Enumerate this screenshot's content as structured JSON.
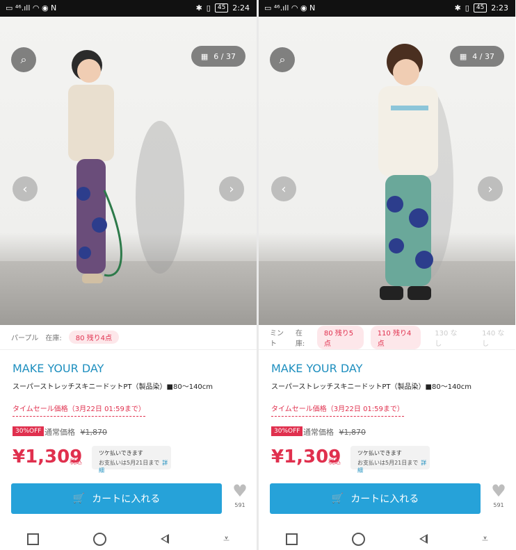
{
  "left": {
    "status": {
      "left_icons": "▭ ⁴⁶.ıll ◠ ◉ N",
      "battery": "45",
      "time": "2:24"
    },
    "counter": {
      "icon": "grid-icon",
      "text": "6 / 37"
    },
    "variants": {
      "color": "パープル",
      "stock_label": "在庫:",
      "chips": [
        {
          "label": "80 残り4点",
          "available": true
        }
      ]
    },
    "product": {
      "brand": "MAKE YOUR DAY",
      "name": "スーパーストレッチスキニードットPT（製品染）■80～140cm",
      "sale_label": "タイムセール価格（3月22日 01:59まで）",
      "discount": "30%OFF",
      "regular_label": "通常価格",
      "regular_price": "¥1,870",
      "price": "¥1,309",
      "tax": "税込",
      "bnpl_line1": "ツケ払いできます",
      "bnpl_line2": "お支払いは5月21日まで",
      "bnpl_link": "詳細",
      "cart_label": "カートに入れる",
      "likes": "591"
    }
  },
  "right": {
    "status": {
      "left_icons": "▭ ⁴⁶.ıll ◠ ◉ N",
      "battery": "45",
      "time": "2:23"
    },
    "counter": {
      "icon": "grid-icon",
      "text": "4 / 37"
    },
    "variants": {
      "color": "ミント",
      "stock_label": "在庫:",
      "chips": [
        {
          "label": "80 残り5点",
          "available": true
        },
        {
          "label": "110 残り4点",
          "available": true
        },
        {
          "label": "130 なし",
          "available": false
        },
        {
          "label": "140 なし",
          "available": false
        }
      ]
    },
    "product": {
      "brand": "MAKE YOUR DAY",
      "name": "スーパーストレッチスキニードットPT（製品染）■80～140cm",
      "sale_label": "タイムセール価格（3月22日 01:59まで）",
      "discount": "30%OFF",
      "regular_label": "通常価格",
      "regular_price": "¥1,870",
      "price": "¥1,309",
      "tax": "税込",
      "bnpl_line1": "ツケ払いできます",
      "bnpl_line2": "お支払いは5月21日まで",
      "bnpl_link": "詳細",
      "cart_label": "カートに入れる",
      "likes": "591"
    }
  },
  "colors": {
    "brand_blue": "#1e8fbf",
    "cart_blue": "#26a2d9",
    "sale_red": "#e0304e"
  },
  "icons": {
    "scan": "scan-search-icon",
    "prev": "chevron-left-icon",
    "next": "chevron-right-icon",
    "cart": "cart-icon",
    "like": "heart-icon"
  }
}
